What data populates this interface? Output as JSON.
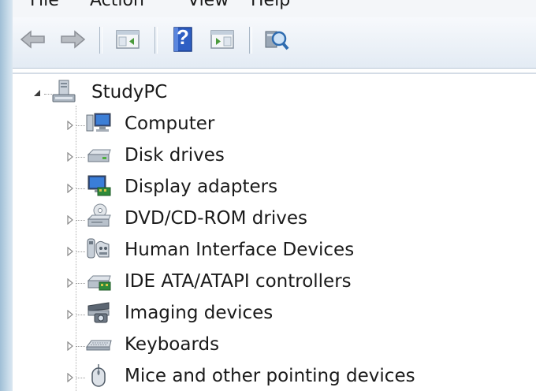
{
  "menubar": {
    "items": [
      {
        "label": "File"
      },
      {
        "label": "Action"
      },
      {
        "label": "View"
      },
      {
        "label": "Help"
      }
    ]
  },
  "toolbar": {
    "help_glyph": "?"
  },
  "tree": {
    "root": {
      "label": "StudyPC",
      "icon": "computer-tower-icon"
    },
    "children": [
      {
        "label": "Computer",
        "icon": "computer-icon"
      },
      {
        "label": "Disk drives",
        "icon": "disk-drive-icon"
      },
      {
        "label": "Display adapters",
        "icon": "display-adapter-icon"
      },
      {
        "label": "DVD/CD-ROM drives",
        "icon": "dvd-drive-icon"
      },
      {
        "label": "Human Interface Devices",
        "icon": "hid-icon"
      },
      {
        "label": "IDE ATA/ATAPI controllers",
        "icon": "ide-controller-icon"
      },
      {
        "label": "Imaging devices",
        "icon": "imaging-device-icon"
      },
      {
        "label": "Keyboards",
        "icon": "keyboard-icon"
      },
      {
        "label": "Mice and other pointing devices",
        "icon": "mouse-icon"
      }
    ]
  },
  "colors": {
    "help_blue": "#2f5fc4",
    "tree_text": "#1a1a1a"
  }
}
